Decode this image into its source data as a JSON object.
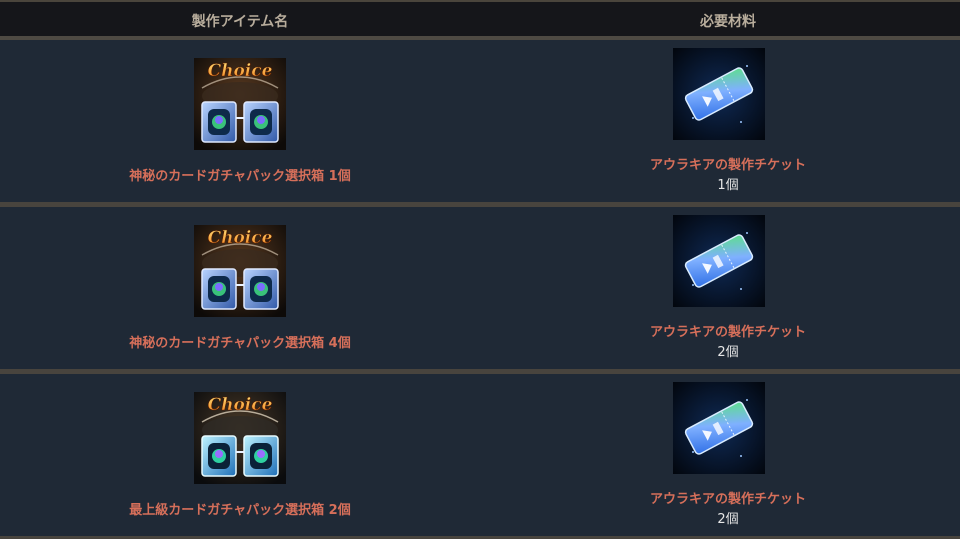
{
  "header": {
    "col_item": "製作アイテム名",
    "col_material": "必要材料"
  },
  "rows": [
    {
      "item_name": "神秘のカードガチャパック選択箱 1個",
      "item_icon": "choice-card-pack-icon",
      "item_variant": "mystic",
      "material_name": "アウラキアの製作チケット",
      "material_icon": "crafting-ticket-icon",
      "material_qty": "1個"
    },
    {
      "item_name": "神秘のカードガチャパック選択箱 4個",
      "item_icon": "choice-card-pack-icon",
      "item_variant": "mystic",
      "material_name": "アウラキアの製作チケット",
      "material_icon": "crafting-ticket-icon",
      "material_qty": "2個"
    },
    {
      "item_name": "最上級カードガチャパック選択箱 2個",
      "item_icon": "choice-card-pack-icon",
      "item_variant": "supreme",
      "material_name": "アウラキアの製作チケット",
      "material_icon": "crafting-ticket-icon",
      "material_qty": "2個"
    }
  ],
  "icon_text": {
    "choice_label": "Choice"
  },
  "colors": {
    "header_bg": "#15161a",
    "header_text": "#b8ad9c",
    "row_bg": "#1f2936",
    "item_name_text": "#d66f5a",
    "qty_text": "#e6e6e6",
    "divider": "#48443e"
  }
}
